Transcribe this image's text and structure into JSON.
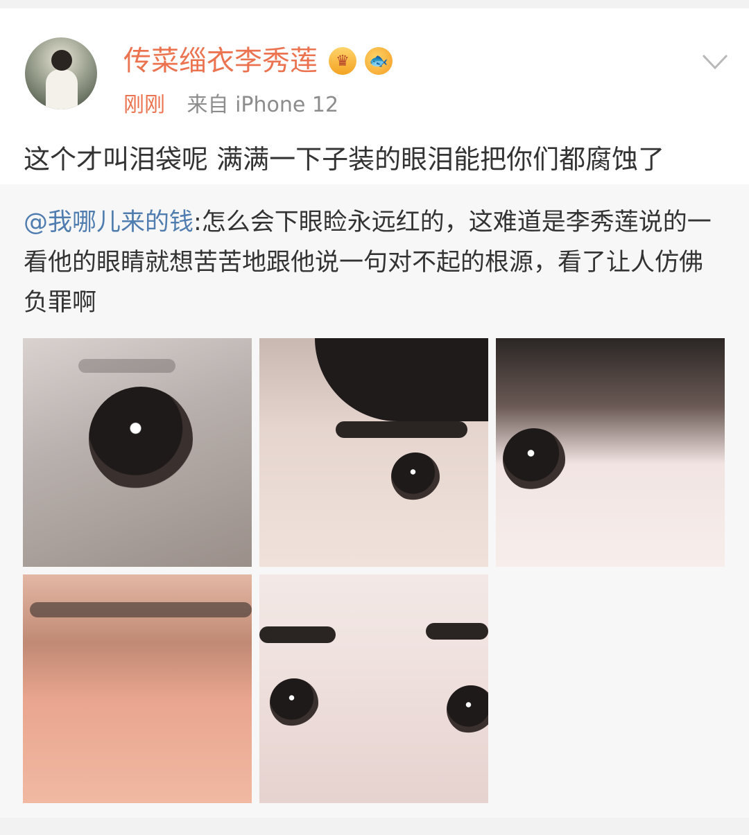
{
  "post": {
    "username": "传菜缁衣李秀莲",
    "time": "刚刚",
    "source": "来自 iPhone 12",
    "text": "这个才叫泪袋呢 满满一下子装的眼泪能把你们都腐蚀了",
    "badges": [
      "crown-badge-icon",
      "fish-badge-icon"
    ]
  },
  "repost": {
    "mention": "@我哪儿来的钱",
    "text": ":怎么会下眼睑永远红的，这难道是李秀莲说的一看他的眼睛就想苦苦地跟他说一句对不起的根源，看了让人仿佛负罪啊",
    "images": [
      "eye-photo-1",
      "eye-photo-2",
      "eye-photo-3",
      "eye-photo-4",
      "eye-photo-5"
    ]
  },
  "colors": {
    "username": "#eb7350",
    "mention": "#507daf",
    "meta_gray": "#8c8c8c",
    "text": "#333333",
    "repost_bg": "#f7f7f7"
  }
}
